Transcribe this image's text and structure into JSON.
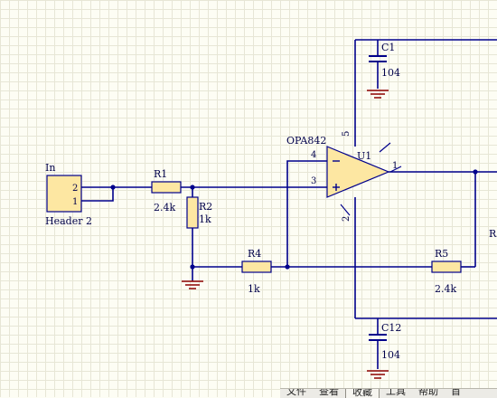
{
  "schematic": {
    "connector": {
      "title": "In",
      "name": "Header 2",
      "pin_top": "2",
      "pin_bottom": "1"
    },
    "resistors": [
      {
        "ref": "R1",
        "value": "2.4k"
      },
      {
        "ref": "R2",
        "value": "1k"
      },
      {
        "ref": "R4",
        "value": "1k"
      },
      {
        "ref": "R5",
        "value": "2.4k"
      }
    ],
    "r_right_partial": "R",
    "opamp": {
      "ref": "U1",
      "part": "OPA842",
      "pin_inv": "4",
      "pin_noninv": "3",
      "pin_out": "1",
      "pin_vplus": "5",
      "pin_vminus": "2"
    },
    "capacitors": [
      {
        "ref": "C1",
        "value": "104"
      },
      {
        "ref": "C12",
        "value": "104"
      }
    ]
  },
  "menubar": {
    "items": [
      "文件",
      "查看",
      "收藏",
      "工具",
      "帮助",
      "首"
    ]
  },
  "colors": {
    "wire": "#00008b",
    "ground": "#8b0000",
    "part_fill": "#fde7a2",
    "grid": "#e7e6d6"
  }
}
